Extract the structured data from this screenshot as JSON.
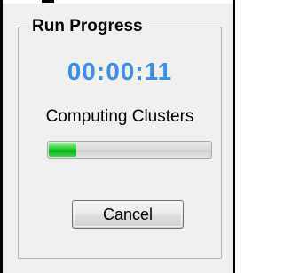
{
  "window": {
    "title": "Run Progress"
  },
  "timer": {
    "elapsed": "00:00:11",
    "color": "#3d8ee6"
  },
  "status": {
    "label": "Computing Clusters"
  },
  "progress": {
    "fraction": 0.17,
    "fill_color": "#2ccd3a"
  },
  "actions": {
    "cancel_label": "Cancel"
  }
}
